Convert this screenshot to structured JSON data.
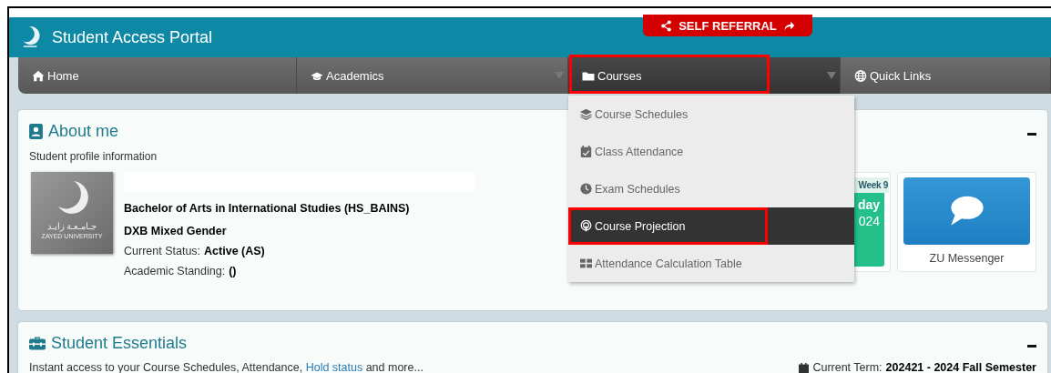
{
  "header": {
    "title": "Student Access Portal",
    "referral_button": "SELF REFERRAL"
  },
  "nav": [
    {
      "label": "Home",
      "kind": "home",
      "selected": false,
      "highlighted": false,
      "caret": false
    },
    {
      "label": "Academics",
      "kind": "academic",
      "selected": false,
      "highlighted": false,
      "caret": true
    },
    {
      "label": "Courses",
      "kind": "courses",
      "selected": true,
      "highlighted": true,
      "caret": true
    },
    {
      "label": "Quick Links",
      "kind": "links",
      "selected": false,
      "highlighted": false,
      "caret": false
    }
  ],
  "dropdown": [
    {
      "label": "Course Schedules",
      "kind": "schedules",
      "selected": false,
      "highlighted": false
    },
    {
      "label": "Class Attendance",
      "kind": "attendance",
      "selected": false,
      "highlighted": false
    },
    {
      "label": "Exam Schedules",
      "kind": "exams",
      "selected": false,
      "highlighted": false
    },
    {
      "label": "Course Projection",
      "kind": "projection",
      "selected": true,
      "highlighted": true
    },
    {
      "label": "Attendance Calculation Table",
      "kind": "calculation",
      "selected": false,
      "highlighted": false
    }
  ],
  "about": {
    "title": "About me",
    "subtitle": "Student profile information",
    "logo": {
      "arabic": "جـامـعـة زايـد",
      "latin": "ZAYED UNIVERSITY"
    },
    "program": "Bachelor of Arts in International Studies (HS_BAINS)",
    "campus": "DXB Mixed Gender",
    "fields": [
      {
        "label": "Current Status:",
        "value": "Active (AS)"
      },
      {
        "label": "Academic Standing:",
        "value": "()"
      }
    ],
    "tiles": [
      {
        "kind": "calendar",
        "header": "Week 9",
        "line_1": "day",
        "line_2": "024"
      },
      {
        "kind": "messenger",
        "label": "ZU Messenger"
      }
    ]
  },
  "essentials": {
    "title": "Student Essentials",
    "intro_before": "Instant access to your Course Schedules, Attendance, ",
    "intro_link": "Hold status",
    "intro_after": " and more...",
    "term_label": "Current Term:",
    "term_value": "202421 - 2024 Fall Semester"
  }
}
